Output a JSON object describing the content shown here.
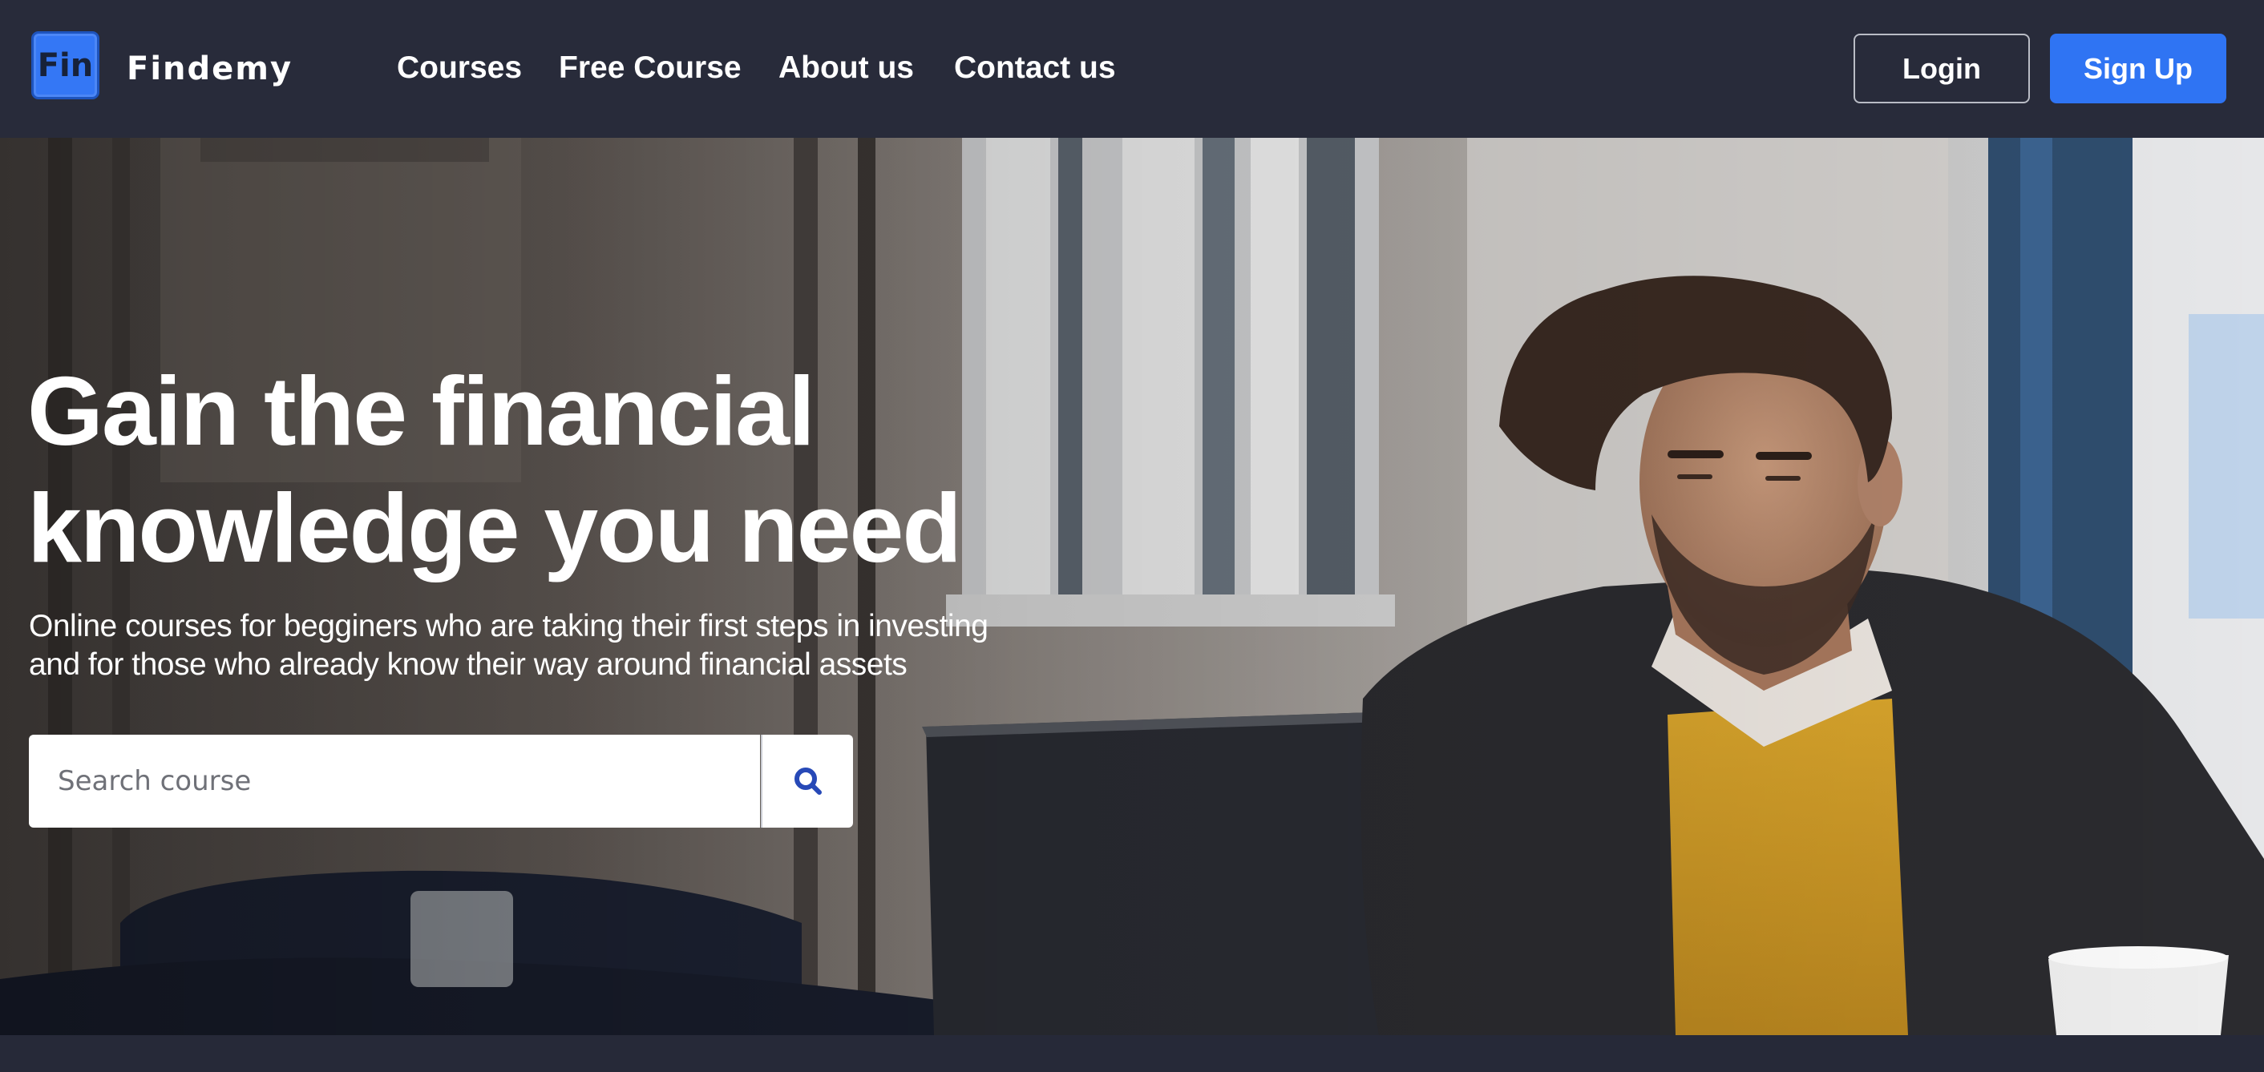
{
  "header": {
    "logo_text": "Fin",
    "brand_name": "Findemy",
    "nav": {
      "courses": "Courses",
      "free_course": "Free Course",
      "about": "About us",
      "contact": "Contact us"
    },
    "login_label": "Login",
    "signup_label": "Sign Up"
  },
  "hero": {
    "title_line1": "Gain the financial",
    "title_line2": "knowledge you need",
    "subtitle_line1": "Online courses for begginers who are taking their first steps in investing",
    "subtitle_line2": "and for those who already know their way around financial assets",
    "search": {
      "placeholder": "Search course",
      "value": ""
    },
    "search_icon": "magnifier-icon"
  },
  "colors": {
    "header_bg": "#282b3a",
    "accent_blue": "#2f74f3",
    "logo_blue": "#3477f5",
    "icon_blue": "#2749b7",
    "page_bg": "#262938"
  }
}
